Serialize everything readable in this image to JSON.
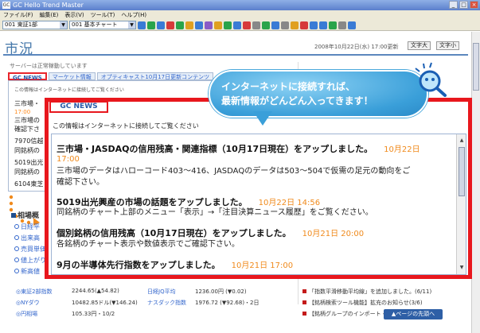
{
  "window": {
    "title": "GC Hello Trend Master",
    "app_icon": "GC"
  },
  "menu": [
    "ファイル(F)",
    "編集(E)",
    "表示(V)",
    "ツール(T)",
    "ヘルプ(H)"
  ],
  "toolbar": {
    "combo1": "001 東証1部",
    "combo2": "001 基本チャート"
  },
  "header": {
    "title": "市況",
    "timestamp": "2008年10月22日(水) 17:00更新",
    "font_large": "文字大",
    "font_small": "文字小"
  },
  "status": "サーバーは正常稼動しています",
  "tabs": [
    "GC NEWS",
    "マーケット情報",
    "オプティキャスト10月17日更新コンテンツ"
  ],
  "bg_news": [
    "この情報はインターネットに接続してご覧ください",
    "三市場・",
    "三市場の",
    "確認下さ",
    "7970信越",
    "同銘柄の",
    "5019出光",
    "同銘柄の",
    "6104東芝"
  ],
  "bg_date": "17:00",
  "left_section": {
    "head": "相場概",
    "items": [
      "日経平",
      "出来高",
      "売買単価",
      "値上がり",
      "新高値"
    ]
  },
  "market_rows": [
    {
      "label": "◎東証2部指数",
      "val": "2244.65(▲54.82)",
      "label2": "日経JQ平均",
      "val2": "1236.00円 (▼0.02)"
    },
    {
      "label": "◎NYダウ",
      "val": "10482.85ドル(▼146.24)",
      "label2": "ナスダック指数",
      "val2": "1976.72 (▼92.68)・2日"
    },
    {
      "label": "◎円相場",
      "val": "105.33円・10/2",
      "label2": "",
      "val2": ""
    }
  ],
  "right_news": [
    "「指数平滑移動平均線」を追加しました。(6/11)",
    "【銘柄検索ツール機能】拡充のお知らせ(3/6)",
    "【銘柄グループのインポート・"
  ],
  "next_button": "▲ページの先頭へ",
  "popup": {
    "tab": "GC NEWS",
    "note": "この情報はインターネットに接続してご覧ください",
    "items": [
      {
        "headline": "三市場・JASDAQの信用残高・関連指標（10月17日現在）をアップしました。",
        "date": "10月22日",
        "date2": "17:00",
        "body": [
          "三市場のデータはハローコード403～416、JASDAQのデータは503～504で仮需の足元の動向をご",
          "確認下さい。"
        ]
      },
      {
        "headline": "5019出光興産の市場の話題をアップしました。",
        "date": "10月22日 14:56",
        "date2": "",
        "body": [
          "同銘柄のチャート上部のメニュー「表示」→「注目決算ニュース履歴」をご覧ください。"
        ]
      },
      {
        "headline": "個別銘柄の信用残高（10月17日現在）をアップしました。",
        "date": "10月21日 20:00",
        "date2": "",
        "body": [
          "各銘柄のチャート表示や数値表示でご確認下さい。"
        ]
      },
      {
        "headline": "9月の半導体先行指数をアップしました。",
        "date": "10月21日 17:00",
        "date2": "",
        "body": []
      }
    ]
  },
  "bubble": {
    "line1": "インターネットに接続すれば、",
    "line2": "最新情報がどんどん入ってきます！"
  },
  "colors": {
    "accent_red": "#e8171d",
    "link_blue": "#3366cc",
    "date_orange": "#f08a1c",
    "bubble_blue": "#3a9fd9"
  }
}
